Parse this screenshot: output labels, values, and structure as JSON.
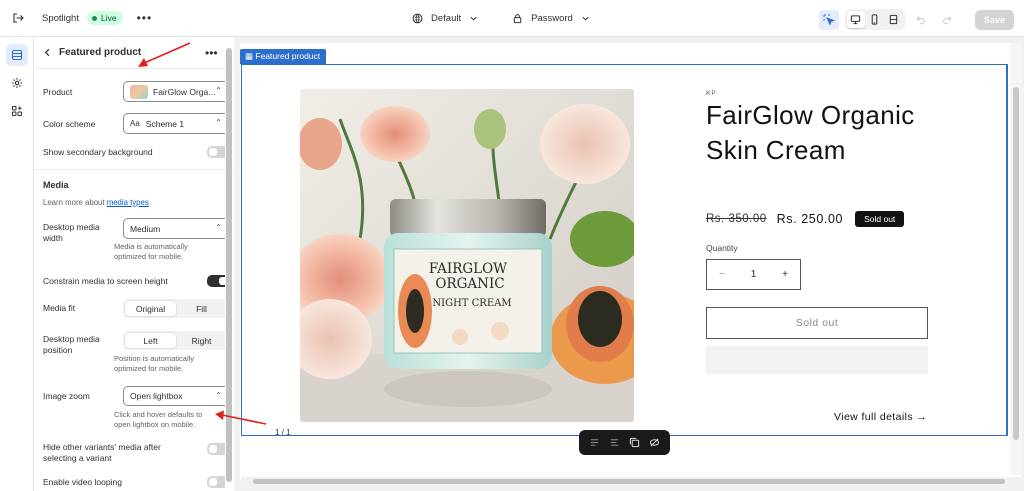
{
  "topbar": {
    "store_name": "Spotlight",
    "status": "Live",
    "theme": "Default",
    "page": "Password",
    "save_label": "Save"
  },
  "panel": {
    "title": "Featured product",
    "product_label": "Product",
    "product_value": "FairGlow Orga...",
    "color_scheme_label": "Color scheme",
    "color_scheme_value": "Scheme 1",
    "color_scheme_swatch": "Aa",
    "secondary_bg_label": "Show secondary background",
    "media_section": "Media",
    "learn_more_prefix": "Learn more about ",
    "learn_more_link": "media types",
    "desktop_media_width_label": "Desktop media width",
    "desktop_media_width_value": "Medium",
    "desktop_media_width_help": "Media is automatically optimized for mobile.",
    "constrain_label": "Constrain media to screen height",
    "media_fit_label": "Media fit",
    "media_fit_options": [
      "Original",
      "Fill"
    ],
    "media_fit_selected": "Original",
    "desktop_media_position_label": "Desktop media position",
    "position_options": [
      "Left",
      "Right"
    ],
    "position_selected": "Left",
    "position_help": "Position is automatically optimized for mobile.",
    "image_zoom_label": "Image zoom",
    "image_zoom_value": "Open lightbox",
    "image_zoom_help": "Click and hover defaults to open lightbox on mobile.",
    "hide_variants_label": "Hide other variants' media after selecting a variant",
    "video_looping_label": "Enable video looping"
  },
  "toggles": {
    "secondary_bg": false,
    "constrain_media": true,
    "hide_variants": false,
    "video_looping": false
  },
  "preview": {
    "section_tag": "Featured product",
    "vendor": "KP",
    "product_title": "FairGlow Organic Skin Cream",
    "old_price": "Rs. 350.00",
    "new_price": "Rs. 250.00",
    "sold_badge": "Sold out",
    "quantity_label": "Quantity",
    "quantity_value": "1",
    "minus": "−",
    "plus": "+",
    "sold_out_button": "Sold out",
    "view_details": "View full details →",
    "media_counter": "1 / 1",
    "jar_line1": "FAIRGLOW",
    "jar_line2": "ORGANIC",
    "jar_line3": "NIGHT CREAM"
  },
  "colors": {
    "accent": "#2c6ecb",
    "live_bg": "#cdfee1",
    "arrow": "#e0201b"
  }
}
